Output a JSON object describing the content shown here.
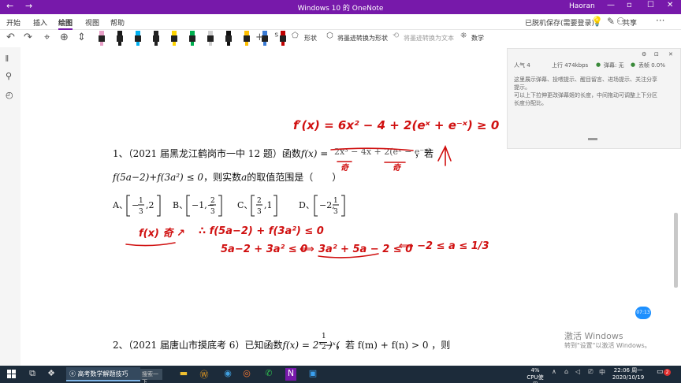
{
  "window": {
    "title": "Windows 10 的 OneNote",
    "user": "Haoran"
  },
  "menu": {
    "items": [
      "开始",
      "插入",
      "绘图",
      "视图",
      "帮助"
    ],
    "saved": "已脱机保存(需要登录)",
    "share": "共享"
  },
  "toolbar": {
    "shape": "形状",
    "ink_to_shape": "将墨迹转换为形状",
    "ink_to_text": "将墨迹转换为文本",
    "math": "数学",
    "pen_colors": [
      "#e8a0c8",
      "#1a1a1a",
      "#00b0f0",
      "#222222",
      "#ffd400",
      "#00b050",
      "#cfcfcf",
      "#111111",
      "#ffbf00",
      "#3a7bd5",
      "#c00000"
    ]
  },
  "panel": {
    "popularity": "人气 4",
    "upload": "上行 474kbps",
    "danmu": "弹幕: 无",
    "drop": "丢帧 0.0%",
    "lines": [
      "这里展示弹幕、投喂提示、醒目留言、进场提示、关注分享",
      "提示。",
      "可以上下拉伸更改弹幕姬的长度，中间拖动可调整上下分区",
      "长度分配比。"
    ]
  },
  "doc": {
    "q1": {
      "num": "1、",
      "source": "（2021 届黑龙江鹤岗市一中 12 题）函数",
      "fx": "f(x) =",
      "struck": "2x³ − 4x + 2(eˣ − e⁻ˣ)",
      "ruo": "，若",
      "cond_a": "f(5a−2)+f(3a²) ≤ 0",
      "cond_b": "，则实数",
      "cond_var": "a",
      "cond_c": "的取值范围是（　　）",
      "options": [
        {
          "label": "A、",
          "l": "−",
          "n": "1",
          "d": "3",
          "r": ",2"
        },
        {
          "label": "B、",
          "l": "−1,−",
          "n": "2",
          "d": "3",
          "r": ""
        },
        {
          "label": "C、",
          "l": "",
          "n": "2",
          "d": "3",
          "r": ",1"
        },
        {
          "label": "D、",
          "l": "−2,",
          "n": "1",
          "d": "3",
          "r": ""
        }
      ]
    },
    "q2": {
      "num": "2、",
      "source": "（2021 届唐山市摸底考 6）已知函数",
      "fx": "f(x) = 2ˣ − (",
      "frac_n": "1",
      "frac_d": "2",
      "exp": ")ˣ",
      "rest": "，若 f(m) + f(n) > 0 ，则"
    },
    "ink": {
      "derivative": "f′(x) = 6x² − 4 + 2(eˣ + e⁻ˣ) ≥ 0",
      "odd": "奇",
      "odd2": "奇",
      "fodd": "f(x) 奇 ↗",
      "step1": "∴ f(5a−2) + f(3a²) ≤ 0",
      "step2": "5a−2 + 3a² ≤ 0",
      "step3": "3a² + 5a − 2 ≤ 0",
      "step4": "⟺ −2 ≤ a ≤ 1/3",
      "iff": "⟺"
    }
  },
  "timer": "07:13",
  "activation": {
    "line1": "激活 Windows",
    "line2": "转到\"设置\"以激活 Windows。"
  },
  "taskbar": {
    "search": "搜索一下",
    "app_title": "高考数学解题技巧",
    "cpu_pct": "4%",
    "cpu_label": "CPU使用",
    "ime": "中",
    "time": "22:06 周一",
    "date": "2020/10/19",
    "badge": "2"
  }
}
